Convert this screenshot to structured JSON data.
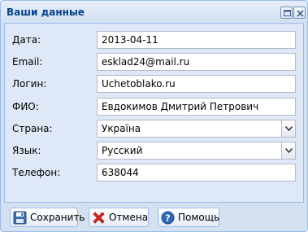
{
  "window": {
    "title": "Ваши данные"
  },
  "form": {
    "date": {
      "label": "Дата:",
      "value": "2013-04-11"
    },
    "email": {
      "label": "Email:",
      "value": "esklad24@mail.ru"
    },
    "login": {
      "label": "Логин:",
      "value": "Uchetoblako.ru"
    },
    "fio": {
      "label": "ФИО:",
      "value": "Евдокимов Дмитрий Петрович"
    },
    "country": {
      "label": "Страна:",
      "value": "Україна"
    },
    "language": {
      "label": "Язык:",
      "value": "Русский"
    },
    "phone": {
      "label": "Телефон:",
      "value": "638044"
    }
  },
  "buttons": {
    "save": "Сохранить",
    "cancel": "Отмена",
    "help": "Помощь"
  },
  "icons": {
    "save": "floppy-disk-icon",
    "cancel": "red-x-icon",
    "help": "question-mark-icon",
    "maximize": "maximize-icon",
    "close": "close-icon",
    "dropdown": "chevron-down-icon"
  },
  "colors": {
    "title": "#04408c",
    "window_bg": "#dfe8f6",
    "border": "#99bbe8"
  }
}
